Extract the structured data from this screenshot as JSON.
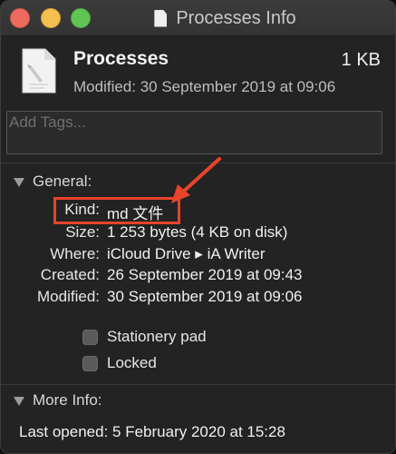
{
  "window": {
    "title": "Processes Info"
  },
  "file": {
    "name": "Processes",
    "size": "1 KB",
    "modified": "Modified: 30 September 2019 at 09:06"
  },
  "tags": {
    "placeholder": "Add Tags..."
  },
  "general": {
    "header": "General:",
    "rows": [
      {
        "label": "Kind:",
        "value": "md 文件"
      },
      {
        "label": "Size:",
        "value": "1 253 bytes (4 KB on disk)"
      },
      {
        "label": "Where:",
        "value": "iCloud Drive ▸ iA Writer"
      },
      {
        "label": "Created:",
        "value": "26 September 2019 at 09:43"
      },
      {
        "label": "Modified:",
        "value": "30 September 2019 at 09:06"
      }
    ],
    "checkboxes": [
      {
        "label": "Stationery pad",
        "checked": false
      },
      {
        "label": "Locked",
        "checked": false
      }
    ]
  },
  "more_info": {
    "header": "More Info:",
    "last_opened": "Last opened: 5 February 2020 at 15:28"
  },
  "annotation": {
    "color": "#e8432b"
  }
}
